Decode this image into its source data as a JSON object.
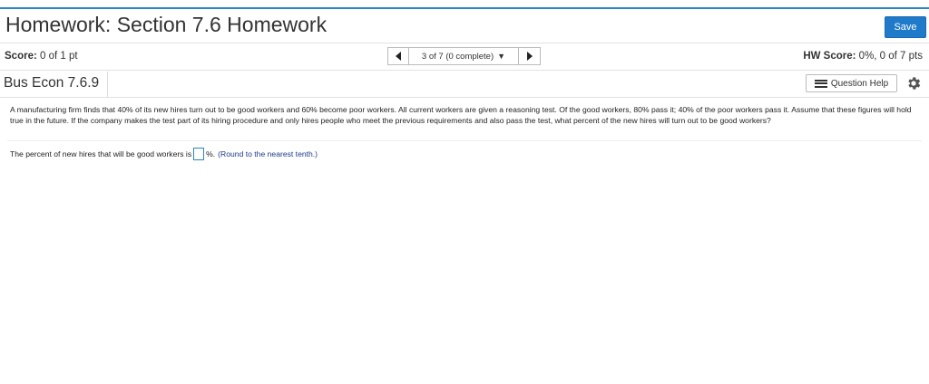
{
  "header": {
    "title": "Homework: Section 7.6 Homework",
    "save_label": "Save"
  },
  "status": {
    "score_label": "Score:",
    "score_value": "0 of 1 pt",
    "nav_position": "3 of 7 (0 complete)",
    "hw_score_label": "HW Score:",
    "hw_score_value": "0%, 0 of 7 pts"
  },
  "question": {
    "name": "Bus Econ 7.6.9",
    "help_label": "Question Help",
    "text": "A manufacturing firm finds that 40% of its new hires turn out to be good workers and 60% become poor workers. All current workers are given a reasoning test. Of the good workers, 80% pass it; 40% of the poor workers pass it. Assume that these figures will hold true in the future. If the company makes the test part of its hiring procedure and only hires people who meet the previous requirements and also pass the test, what percent of the new hires will turn out to be good workers?",
    "prompt": "The percent of new hires that will be good workers is",
    "answer_value": "",
    "unit": "%.",
    "hint": "(Round to the nearest tenth.)"
  },
  "icons": {
    "prev": "triangle-left-icon",
    "next": "triangle-right-icon",
    "dropdown": "caret-down-icon",
    "help": "list-icon",
    "settings": "gear-icon"
  },
  "colors": {
    "accent": "#2a86c6",
    "save_button": "#1f7ac9",
    "hint_text": "#1c3a8a"
  }
}
